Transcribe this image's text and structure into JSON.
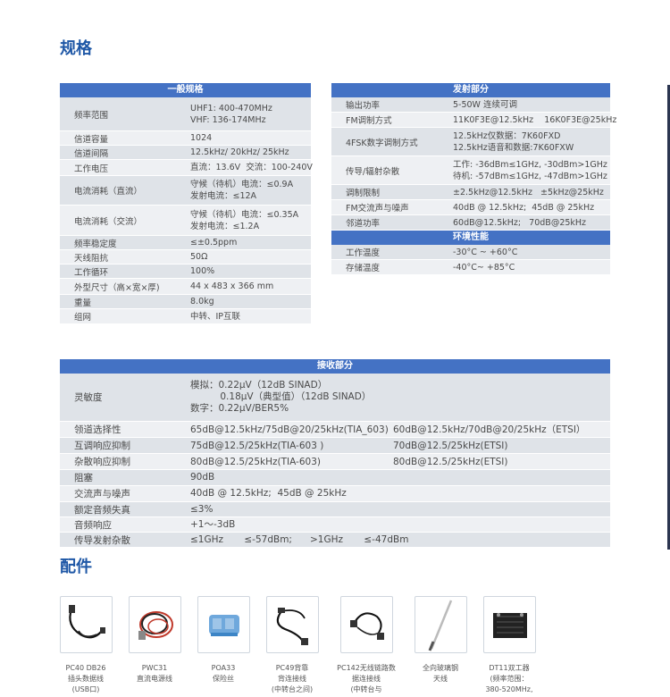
{
  "titles": {
    "spec": "规格",
    "acc": "配件"
  },
  "general": {
    "header": "一般规格",
    "rows": [
      {
        "k": "频率范围",
        "v": [
          "UHF1: 400-470MHz",
          "VHF: 136-174MHz"
        ]
      },
      {
        "k": "信道容量",
        "v": [
          "1024"
        ]
      },
      {
        "k": "信道间隔",
        "v": [
          "12.5kHz/ 20kHz/ 25kHz"
        ]
      },
      {
        "k": "工作电压",
        "v": [
          "直流：13.6V  交流：100-240V"
        ]
      },
      {
        "k": "电流消耗（直流）",
        "v": [
          "守候（待机）电流：≤0.9A",
          "发射电流：≤12A"
        ]
      },
      {
        "k": "电流消耗（交流）",
        "v": [
          "守候（待机）电流：≤0.35A",
          "发射电流：≤1.2A"
        ]
      },
      {
        "k": "频率稳定度",
        "v": [
          "≤±0.5ppm"
        ]
      },
      {
        "k": "天线阻抗",
        "v": [
          "50Ω"
        ]
      },
      {
        "k": "工作循环",
        "v": [
          "100%"
        ]
      },
      {
        "k": "外型尺寸（高×宽×厚)",
        "v": [
          "44 x 483 x 366 mm"
        ]
      },
      {
        "k": "重量",
        "v": [
          "8.0kg"
        ]
      },
      {
        "k": "组网",
        "v": [
          "中转、IP互联"
        ]
      }
    ]
  },
  "transmit": {
    "header": "发射部分",
    "rows": [
      {
        "k": "输出功率",
        "v": [
          "5-50W 连续可调"
        ]
      },
      {
        "k": "FM调制方式",
        "v": [
          "11K0F3E@12.5kHz    16K0F3E@25kHz"
        ]
      },
      {
        "k": "4FSK数字调制方式",
        "v": [
          "12.5kHz仅数据：7K60FXD",
          "12.5kHz语音和数据:7K60FXW"
        ]
      },
      {
        "k": "传导/辐射杂散",
        "v": [
          "工作: -36dBm≤1GHz, -30dBm>1GHz",
          "待机: -57dBm≤1GHz, -47dBm>1GHz"
        ]
      },
      {
        "k": "调制限制",
        "v": [
          "±2.5kHz@12.5kHz   ±5kHz@25kHz"
        ]
      },
      {
        "k": "FM交流声与噪声",
        "v": [
          "40dB @ 12.5kHz;  45dB @ 25kHz"
        ]
      },
      {
        "k": "邻道功率",
        "v": [
          "60dB@12.5kHz;   70dB@25kHz"
        ]
      }
    ]
  },
  "env": {
    "header": "环境性能",
    "rows": [
      {
        "k": "工作温度",
        "v": [
          "-30°C ~ +60°C"
        ]
      },
      {
        "k": "存储温度",
        "v": [
          "-40°C~ +85°C"
        ]
      }
    ]
  },
  "receive": {
    "header": "接收部分",
    "rows": [
      {
        "k": "灵敏度",
        "v": [
          "模拟：0.22μV（12dB SINAD）",
          "          0.18μV（典型值）（12dB SINAD）",
          "数字：0.22μV/BER5%"
        ]
      },
      {
        "k": "领道选择性",
        "v": [
          "65dB@12.5kHz/75dB@20/25kHz(TIA_603)",
          "60dB@12.5kHz/70dB@20/25kHz（ETSI）"
        ]
      },
      {
        "k": "互调响应抑制",
        "v": [
          "75dB@12.5/25kHz(TIA-603 )",
          "70dB@12.5/25kHz(ETSI)"
        ]
      },
      {
        "k": "杂散响应抑制",
        "v": [
          "80dB@12.5/25kHz(TIA-603)",
          "80dB@12.5/25kHz(ETSI)"
        ]
      },
      {
        "k": "阻塞",
        "v": [
          "90dB"
        ]
      },
      {
        "k": "交流声与噪声",
        "v": [
          "40dB @ 12.5kHz;  45dB @ 25kHz"
        ]
      },
      {
        "k": "额定音频失真",
        "v": [
          "≤3%"
        ]
      },
      {
        "k": "音频响应",
        "v": [
          "+1～-3dB"
        ]
      },
      {
        "k": "传导发射杂散",
        "v": [
          "≤1GHz       ≤-57dBm;      >1GHz       ≤-47dBm"
        ]
      }
    ]
  },
  "accessories": [
    {
      "icon": "usb-cable-icon",
      "cap": [
        "PC40 DB26",
        "插头数据线",
        "(USB口)"
      ]
    },
    {
      "icon": "power-cable-icon",
      "cap": [
        "PWC31",
        "直流电源线"
      ]
    },
    {
      "icon": "fuse-icon",
      "cap": [
        "POA33",
        "保险丝"
      ]
    },
    {
      "icon": "back-cable-icon",
      "cap": [
        "PC49背靠",
        "背连接线",
        "(中转台之间)"
      ]
    },
    {
      "icon": "link-cable-icon",
      "cap": [
        "PC142无线链路数",
        "据连接线",
        "(中转台与"
      ]
    },
    {
      "icon": "antenna-icon",
      "cap": [
        "全向玻璃钢",
        "天线"
      ]
    },
    {
      "icon": "duplexer-icon",
      "cap": [
        "DT11双工器",
        "(频率范围：",
        "380-520MHz,"
      ]
    }
  ]
}
